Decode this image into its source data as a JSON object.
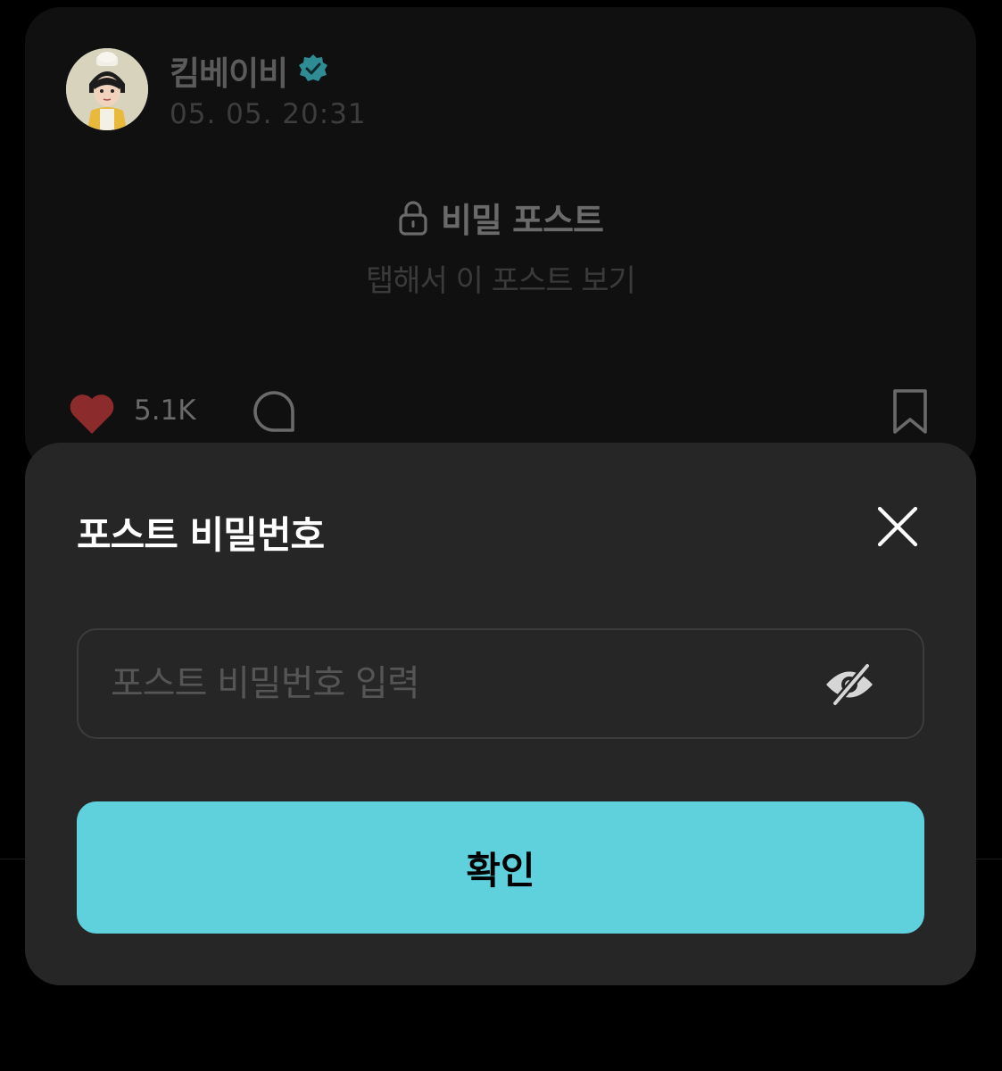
{
  "post": {
    "author_name": "킴베이비",
    "verified": true,
    "timestamp": "05. 05. 20:31",
    "secret_title": "비밀 포스트",
    "secret_subtitle": "탭해서 이 포스트 보기",
    "like_count": "5.1K"
  },
  "password_sheet": {
    "title": "포스트 비밀번호",
    "input_placeholder": "포스트 비밀번호 입력",
    "input_value": "",
    "confirm_label": "확인"
  },
  "colors": {
    "accent": "#5ed1dd",
    "verified_badge": "#2f8c95",
    "heart": "#8c2b2b",
    "sheet_bg": "#262626",
    "card_bg": "#101010"
  },
  "icons": [
    "verified-icon",
    "lock-icon",
    "heart-icon",
    "comment-icon",
    "bookmark-icon",
    "close-icon",
    "eye-off-icon"
  ]
}
